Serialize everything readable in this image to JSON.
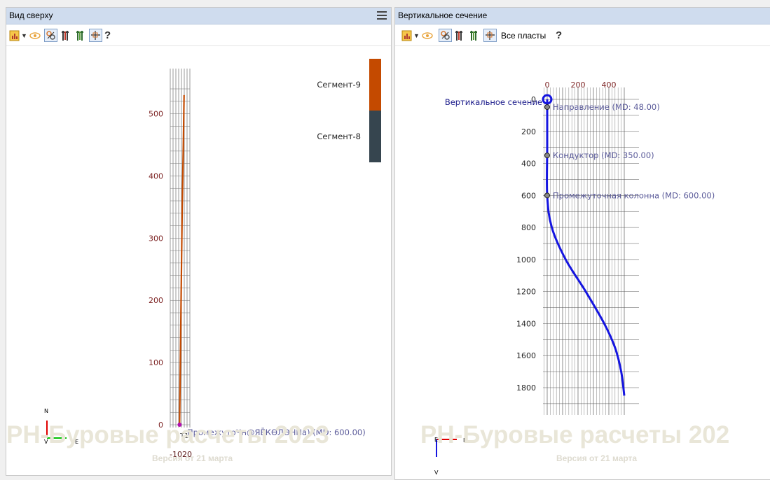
{
  "left": {
    "title": "Вид сверху",
    "legend": [
      {
        "label": "Сегмент-9",
        "color": "#c44a00"
      },
      {
        "label": "Сегмент-8",
        "color": "#36454f"
      }
    ],
    "y_ticks": [
      "0",
      "100",
      "200",
      "300",
      "400",
      "500"
    ],
    "x_ticks": [
      "-10",
      "20"
    ],
    "point_labels": {
      "t1": "T1",
      "overlap": "ПромежутоЧн@ЯЁКӨЛӨННа) (MD: 600.00)"
    },
    "compass": {
      "n": "N",
      "e": "E",
      "v": "V"
    },
    "watermark": "РН-Буровые расчеты 2023",
    "version": "Версия от 21 марта",
    "chart_data": {
      "type": "line",
      "series": [
        {
          "name": "Сегмент-8",
          "x": [
            0,
            3,
            7,
            10
          ],
          "y": [
            0,
            150,
            350,
            450
          ]
        },
        {
          "name": "Сегмент-9",
          "x": [
            10,
            12
          ],
          "y": [
            450,
            530
          ]
        }
      ],
      "ylim": [
        0,
        560
      ],
      "xlim": [
        -10,
        20
      ],
      "grid": true
    }
  },
  "right": {
    "title": "Вертикальное сечение",
    "all_layers": "Все пласты",
    "x_ticks": [
      "0",
      "200",
      "400"
    ],
    "y_ticks": [
      "0",
      "200",
      "400",
      "600",
      "800",
      "1000",
      "1200",
      "1400",
      "1600",
      "1800"
    ],
    "section_label": "Вертикальное сечение",
    "markers": [
      {
        "label": "Направление (MD: 48.00)",
        "md": 48
      },
      {
        "label": "Кондуктор (MD: 350.00)",
        "md": 350
      },
      {
        "label": "Промежуточная колонна (MD: 600.00)",
        "md": 600
      }
    ],
    "compass": {
      "e": "E",
      "n": "N",
      "v": "V"
    },
    "watermark": "РН-Буровые расчеты 202",
    "version": "Версия от 21 марта",
    "chart_data": {
      "type": "line",
      "series": [
        {
          "name": "Вертикальное сечение",
          "x": [
            0,
            0,
            0,
            30,
            120,
            250,
            370,
            440,
            480,
            500
          ],
          "y": [
            0,
            300,
            600,
            800,
            1000,
            1200,
            1400,
            1550,
            1700,
            1850
          ]
        }
      ],
      "xlim": [
        -15,
        510
      ],
      "ylim": [
        1900,
        -30
      ],
      "grid": true
    }
  }
}
